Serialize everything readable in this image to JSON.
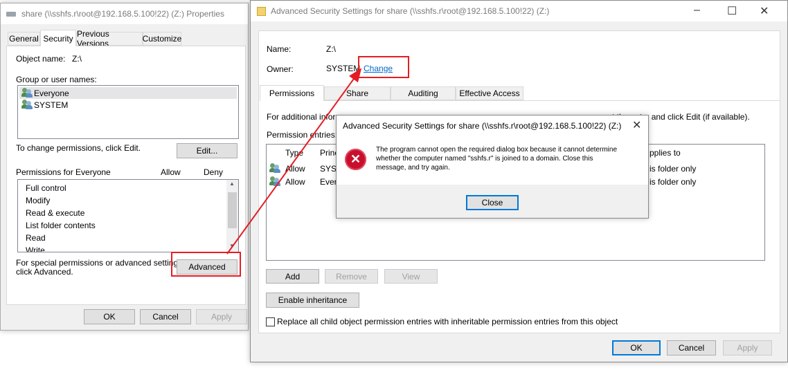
{
  "props": {
    "title": "share (\\\\sshfs.r\\root@192.168.5.100!22) (Z:) Properties",
    "tabs": [
      "General",
      "Security",
      "Previous Versions",
      "Customize"
    ],
    "object_name_label": "Object name:",
    "object_name_value": "Z:\\",
    "group_label": "Group or user names:",
    "users": [
      "Everyone",
      "SYSTEM"
    ],
    "change_hint": "To change permissions, click Edit.",
    "edit_label": "Edit...",
    "perm_label": "Permissions for Everyone",
    "allow_label": "Allow",
    "deny_label": "Deny",
    "perms": [
      "Full control",
      "Modify",
      "Read & execute",
      "List folder contents",
      "Read",
      "Write"
    ],
    "special_line1": "For special permissions or advanced settings,",
    "special_line2": "click Advanced.",
    "advanced_label": "Advanced",
    "ok_label": "OK",
    "cancel_label": "Cancel",
    "apply_label": "Apply"
  },
  "adv": {
    "title": "Advanced Security Settings for share (\\\\sshfs.r\\root@192.168.5.100!22) (Z:)",
    "name_label": "Name:",
    "name_value": "Z:\\",
    "owner_label": "Owner:",
    "owner_value": "SYSTEM",
    "change_link": "Change",
    "tabs": [
      "Permissions",
      "Share",
      "Auditing",
      "Effective Access"
    ],
    "info_left": "For additional infor",
    "info_right": "ct the entry and click Edit (if available).",
    "entries_label": "Permission entries:",
    "col_type": "Type",
    "col_principal": "Princ",
    "col_applies": "pplies to",
    "rows": [
      {
        "type": "Allow",
        "principal": "SYST",
        "applies": "is folder only"
      },
      {
        "type": "Allow",
        "principal": "Every",
        "applies": "is folder only"
      }
    ],
    "add_label": "Add",
    "remove_label": "Remove",
    "view_label": "View",
    "enable_inheritance_label": "Enable inheritance",
    "replace_label": "Replace all child object permission entries with inheritable permission entries from this object",
    "ok_label": "OK",
    "cancel_label": "Cancel",
    "apply_label": "Apply"
  },
  "error": {
    "title": "Advanced Security Settings for share (\\\\sshfs.r\\root@192.168.5.100!22) (Z:)",
    "line1": "The program cannot open the required dialog box because it cannot determine",
    "line2": "whether the computer named \"sshfs.r\" is joined to a domain. Close this",
    "line3": "message, and try again.",
    "close_label": "Close"
  },
  "icons": {
    "minimize": "–",
    "maximize": "☐",
    "close": "✕",
    "error": "✕",
    "scroll_up": "▲",
    "scroll_down": "▼"
  },
  "colors": {
    "accent": "#0078d7",
    "highlight": "#e51c23",
    "error": "#c8102e",
    "link": "#0066cc"
  }
}
